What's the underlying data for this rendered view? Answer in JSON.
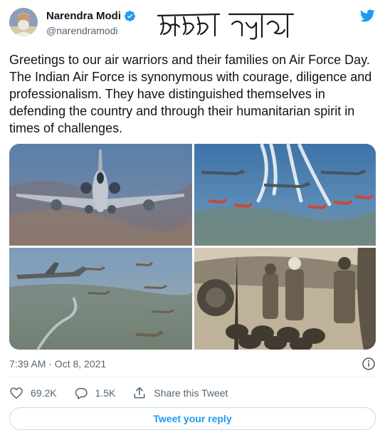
{
  "author": {
    "name": "Narendra Modi",
    "handle": "@narendramodi",
    "verified": true
  },
  "watermark_text": "सारस न्यूज",
  "tweet": {
    "text": "Greetings to our air warriors and their families on Air Force Day. The Indian Air Force is synonymous with courage, diligence and professionalism. They have distinguished themselves in defending the country and through their humanitarian spirit in times of challenges."
  },
  "timestamp": "7:39 AM · Oct 8, 2021",
  "actions": {
    "likes": "69.2K",
    "replies": "1.5K",
    "share_label": "Share this Tweet"
  },
  "reply_button": "Tweet your reply",
  "colors": {
    "accent": "#1d9bf0",
    "text": "#0f1419",
    "muted": "#536471"
  },
  "icons": [
    "verified-badge-icon",
    "twitter-bird-icon",
    "info-icon",
    "heart-icon",
    "reply-icon",
    "share-icon"
  ]
}
